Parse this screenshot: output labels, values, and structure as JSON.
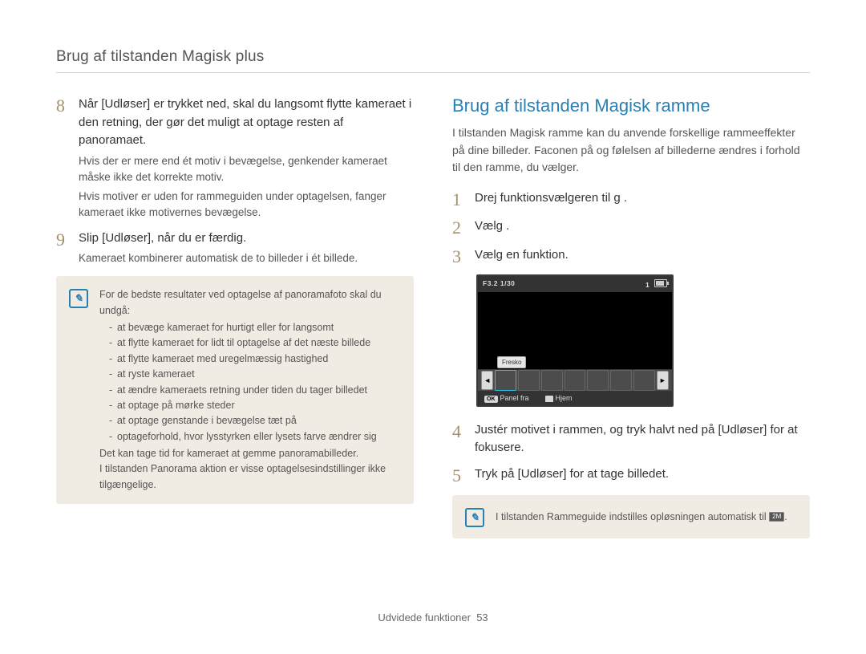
{
  "header": "Brug af tilstanden Magisk plus",
  "left": {
    "step8": {
      "num": "8",
      "text": "Når [Udløser] er trykket ned, skal du langsomt flytte kameraet i den retning, der gør det muligt at optage resten af panoramaet.",
      "sub1": "Hvis der er mere end ét motiv i bevægelse, genkender kameraet måske ikke det korrekte motiv.",
      "sub2": "Hvis motiver er uden for rammeguiden under optagelsen, fanger kameraet ikke motivernes bevægelse."
    },
    "step9": {
      "num": "9",
      "text": "Slip [Udløser], når du er færdig.",
      "sub": "Kameraet kombinerer automatisk de to billeder i ét billede."
    },
    "note": {
      "lead": "For de bedste resultater ved optagelse af panoramafoto skal du undgå:",
      "items": [
        "at bevæge kameraet for hurtigt eller for langsomt",
        "at flytte kameraet for lidt til optagelse af det næste billede",
        "at flytte kameraet med uregelmæssig hastighed",
        "at ryste kameraet",
        "at ændre kameraets retning under tiden du tager billedet",
        "at optage på mørke steder",
        "at optage genstande i bevægelse tæt på",
        "optageforhold, hvor lysstyrken eller lysets farve ændrer sig"
      ],
      "tail1": "Det kan tage tid for kameraet at gemme panoramabilleder.",
      "tail2": "I tilstanden Panorama aktion er visse optagelsesindstillinger ikke tilgængelige."
    }
  },
  "right": {
    "title": "Brug af tilstanden Magisk ramme",
    "intro": "I tilstanden Magisk ramme kan du anvende forskellige rammeeffekter på dine billeder. Faconen på og følelsen af billederne ændres i forhold til den ramme, du vælger.",
    "step1": {
      "num": "1",
      "text": "Drej funktionsvælgeren til g ."
    },
    "step2": {
      "num": "2",
      "text": "Vælg     ."
    },
    "step3": {
      "num": "3",
      "text": "Vælg en funktion."
    },
    "screen": {
      "top_left": "F3.2  1/30",
      "top_right_count": "1",
      "label": "Fresko",
      "bottom_ok": "OK",
      "bottom_panel": "Panel fra",
      "bottom_home": "Hjem"
    },
    "step4": {
      "num": "4",
      "text": "Justér motivet i rammen, og tryk halvt ned på [Udløser] for at fokusere."
    },
    "step5": {
      "num": "5",
      "text": "Tryk på [Udløser] for at tage billedet."
    },
    "note": "I tilstanden Rammeguide indstilles opløsningen automatisk til ",
    "note_chip": "2M"
  },
  "footer": {
    "section": "Udvidede funktioner",
    "page": "53"
  }
}
